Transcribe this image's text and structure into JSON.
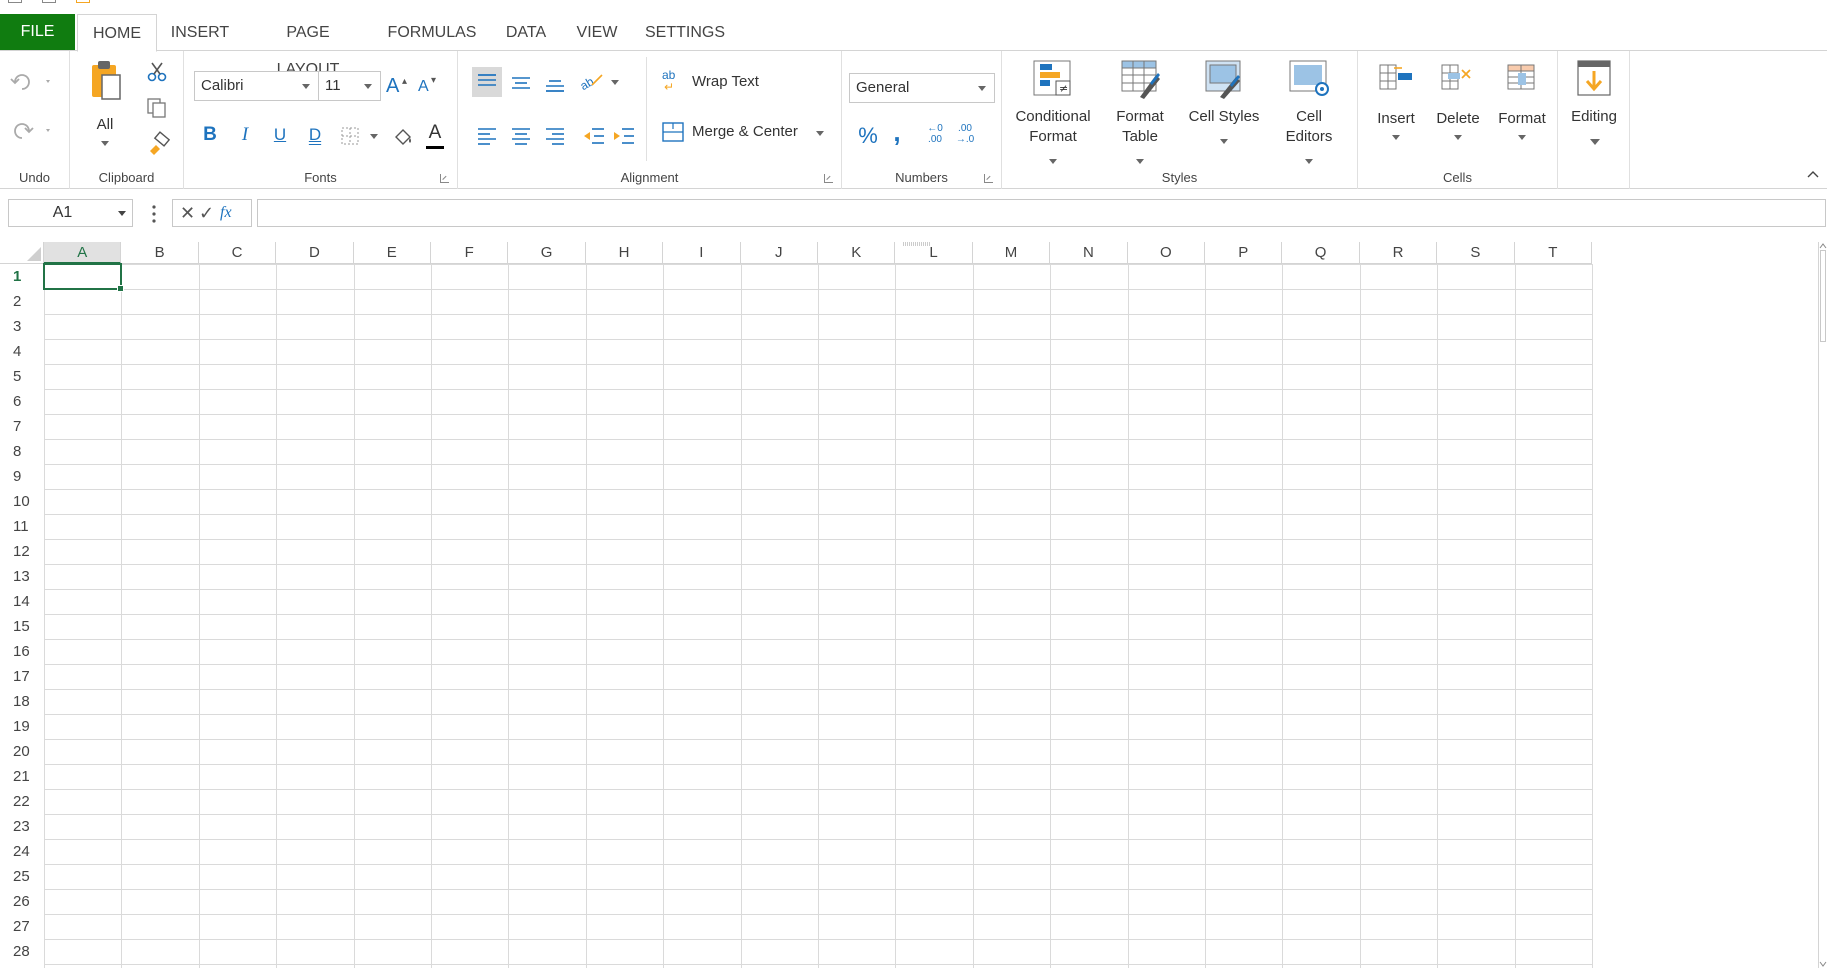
{
  "tabs": [
    {
      "label": "FILE"
    },
    {
      "label": "HOME"
    },
    {
      "label": "INSERT"
    },
    {
      "label": "PAGE LAYOUT"
    },
    {
      "label": "FORMULAS"
    },
    {
      "label": "DATA"
    },
    {
      "label": "VIEW"
    },
    {
      "label": "SETTINGS"
    }
  ],
  "ribbon": {
    "undo": {
      "label": "Undo"
    },
    "clipboard": {
      "label": "Clipboard",
      "paste_label": "All"
    },
    "fonts": {
      "label": "Fonts",
      "font_name": "Calibri",
      "font_size": "11",
      "bold": "B",
      "italic": "I",
      "underline": "U",
      "double_underline": "D",
      "grow": "A",
      "shrink": "A",
      "font_color": "A"
    },
    "alignment": {
      "label": "Alignment",
      "wrap_text": "Wrap Text",
      "merge_center": "Merge & Center",
      "wrap_icon": "ab"
    },
    "numbers": {
      "label": "Numbers",
      "format": "General",
      "percent": "%",
      "comma": ",",
      "inc_decimal_top": "←0",
      "inc_decimal_bottom": ".00",
      "dec_decimal_top": ".00",
      "dec_decimal_bottom": "→.0"
    },
    "styles": {
      "label": "Styles",
      "conditional_format_1": "Conditional",
      "conditional_format_2": "Format",
      "format_table_1": "Format",
      "format_table_2": "Table",
      "cell_styles": "Cell Styles",
      "cell_editors_1": "Cell",
      "cell_editors_2": "Editors"
    },
    "cells": {
      "label": "Cells",
      "insert": "Insert",
      "delete": "Delete",
      "format": "Format"
    },
    "editing": {
      "label": "Editing"
    }
  },
  "formula_bar": {
    "name_box": "A1",
    "fx_label": "fx",
    "formula": ""
  },
  "grid": {
    "columns": [
      "A",
      "B",
      "C",
      "D",
      "E",
      "F",
      "G",
      "H",
      "I",
      "J",
      "K",
      "L",
      "M",
      "N",
      "O",
      "P",
      "Q",
      "R",
      "S",
      "T"
    ],
    "rows": [
      "1",
      "2",
      "3",
      "4",
      "5",
      "6",
      "7",
      "8",
      "9",
      "10",
      "11",
      "12",
      "13",
      "14",
      "15",
      "16",
      "17",
      "18",
      "19",
      "20",
      "21",
      "22",
      "23",
      "24",
      "25",
      "26",
      "27",
      "28"
    ],
    "selected_cell": "A1"
  },
  "colors": {
    "accent": "#217346",
    "file_tab": "#107c10",
    "icon_blue": "#1e73be",
    "icon_orange": "#f5a623"
  }
}
